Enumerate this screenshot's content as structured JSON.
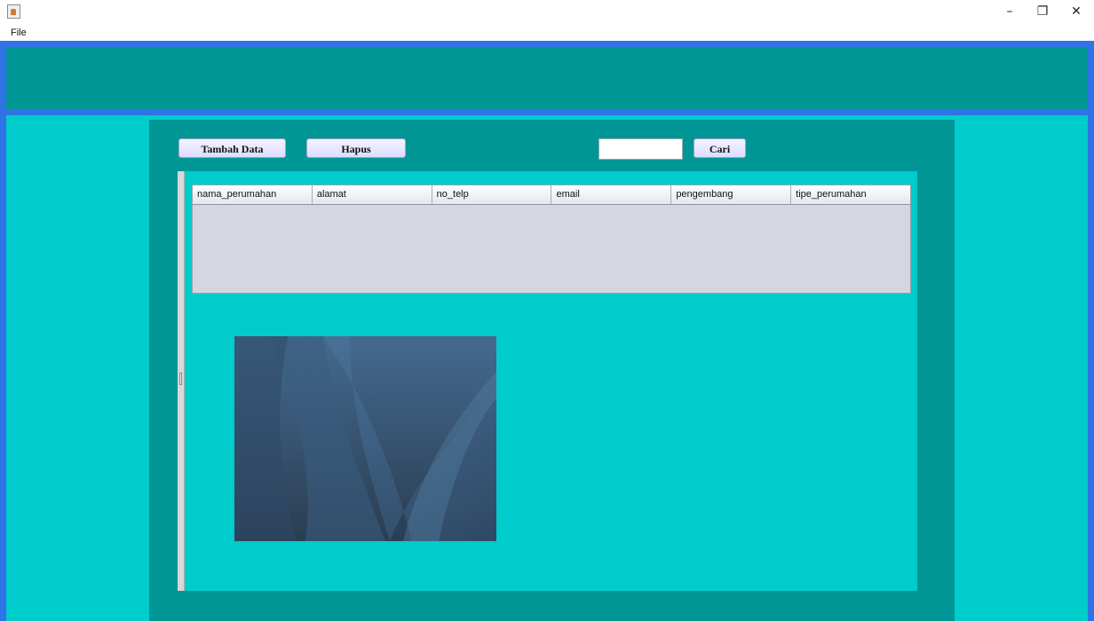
{
  "window": {
    "minimize_glyph": "–",
    "maximize_glyph": "❐",
    "close_glyph": "✕",
    "app_icon": "java-cup-icon"
  },
  "menubar": {
    "items": [
      {
        "label": "File"
      }
    ]
  },
  "toolbar": {
    "add_label": "Tambah Data",
    "delete_label": "Hapus",
    "search_label": "Cari",
    "search_value": ""
  },
  "table": {
    "columns": [
      "nama_perumahan",
      "alamat",
      "no_telp",
      "email",
      "pengembang",
      "tipe_perumahan"
    ],
    "rows": []
  },
  "colors": {
    "frame_border": "#2f74e6",
    "header_teal": "#009696",
    "background_cyan": "#00cccc",
    "table_body": "#d4d7e0"
  }
}
